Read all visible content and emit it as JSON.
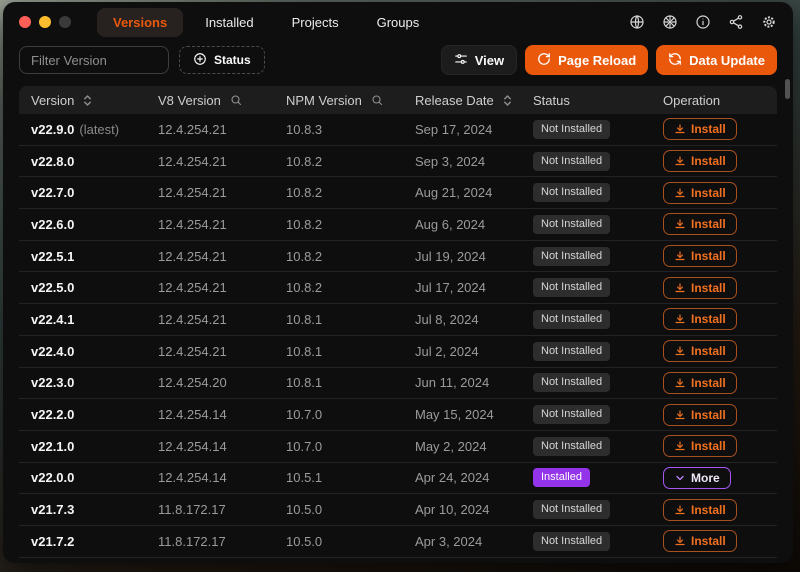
{
  "titlebar": {
    "tabs": [
      {
        "label": "Versions",
        "active": true
      },
      {
        "label": "Installed",
        "active": false
      },
      {
        "label": "Projects",
        "active": false
      },
      {
        "label": "Groups",
        "active": false
      }
    ],
    "icons": [
      "globe-icon",
      "color-wheel-icon",
      "info-icon",
      "share-icon",
      "settings-icon"
    ]
  },
  "toolbar": {
    "filter_placeholder": "Filter Version",
    "status_button": "Status",
    "view_button": "View",
    "page_reload_button": "Page Reload",
    "data_update_button": "Data Update"
  },
  "table": {
    "columns": [
      {
        "label": "Version",
        "icon": "sort"
      },
      {
        "label": "V8 Version",
        "icon": "search"
      },
      {
        "label": "NPM Version",
        "icon": "search"
      },
      {
        "label": "Release Date",
        "icon": "sort"
      },
      {
        "label": "Status",
        "icon": null
      },
      {
        "label": "Operation",
        "icon": null
      }
    ],
    "rows": [
      {
        "version": "v22.9.0",
        "tag": "(latest)",
        "v8": "12.4.254.21",
        "npm": "10.8.3",
        "date": "Sep 17, 2024",
        "status": "Not Installed",
        "action": "Install",
        "installed": false
      },
      {
        "version": "v22.8.0",
        "tag": "",
        "v8": "12.4.254.21",
        "npm": "10.8.2",
        "date": "Sep 3, 2024",
        "status": "Not Installed",
        "action": "Install",
        "installed": false
      },
      {
        "version": "v22.7.0",
        "tag": "",
        "v8": "12.4.254.21",
        "npm": "10.8.2",
        "date": "Aug 21, 2024",
        "status": "Not Installed",
        "action": "Install",
        "installed": false
      },
      {
        "version": "v22.6.0",
        "tag": "",
        "v8": "12.4.254.21",
        "npm": "10.8.2",
        "date": "Aug 6, 2024",
        "status": "Not Installed",
        "action": "Install",
        "installed": false
      },
      {
        "version": "v22.5.1",
        "tag": "",
        "v8": "12.4.254.21",
        "npm": "10.8.2",
        "date": "Jul 19, 2024",
        "status": "Not Installed",
        "action": "Install",
        "installed": false
      },
      {
        "version": "v22.5.0",
        "tag": "",
        "v8": "12.4.254.21",
        "npm": "10.8.2",
        "date": "Jul 17, 2024",
        "status": "Not Installed",
        "action": "Install",
        "installed": false
      },
      {
        "version": "v22.4.1",
        "tag": "",
        "v8": "12.4.254.21",
        "npm": "10.8.1",
        "date": "Jul 8, 2024",
        "status": "Not Installed",
        "action": "Install",
        "installed": false
      },
      {
        "version": "v22.4.0",
        "tag": "",
        "v8": "12.4.254.21",
        "npm": "10.8.1",
        "date": "Jul 2, 2024",
        "status": "Not Installed",
        "action": "Install",
        "installed": false
      },
      {
        "version": "v22.3.0",
        "tag": "",
        "v8": "12.4.254.20",
        "npm": "10.8.1",
        "date": "Jun 11, 2024",
        "status": "Not Installed",
        "action": "Install",
        "installed": false
      },
      {
        "version": "v22.2.0",
        "tag": "",
        "v8": "12.4.254.14",
        "npm": "10.7.0",
        "date": "May 15, 2024",
        "status": "Not Installed",
        "action": "Install",
        "installed": false
      },
      {
        "version": "v22.1.0",
        "tag": "",
        "v8": "12.4.254.14",
        "npm": "10.7.0",
        "date": "May 2, 2024",
        "status": "Not Installed",
        "action": "Install",
        "installed": false
      },
      {
        "version": "v22.0.0",
        "tag": "",
        "v8": "12.4.254.14",
        "npm": "10.5.1",
        "date": "Apr 24, 2024",
        "status": "Installed",
        "action": "More",
        "installed": true
      },
      {
        "version": "v21.7.3",
        "tag": "",
        "v8": "11.8.172.17",
        "npm": "10.5.0",
        "date": "Apr 10, 2024",
        "status": "Not Installed",
        "action": "Install",
        "installed": false
      },
      {
        "version": "v21.7.2",
        "tag": "",
        "v8": "11.8.172.17",
        "npm": "10.5.0",
        "date": "Apr 3, 2024",
        "status": "Not Installed",
        "action": "Install",
        "installed": false
      }
    ]
  },
  "colors": {
    "accent": "#ea580c",
    "installed_badge": "#9333ea",
    "more_border": "#a855f7",
    "traffic_close": "#ff5f57",
    "traffic_minimize": "#febc2e"
  }
}
